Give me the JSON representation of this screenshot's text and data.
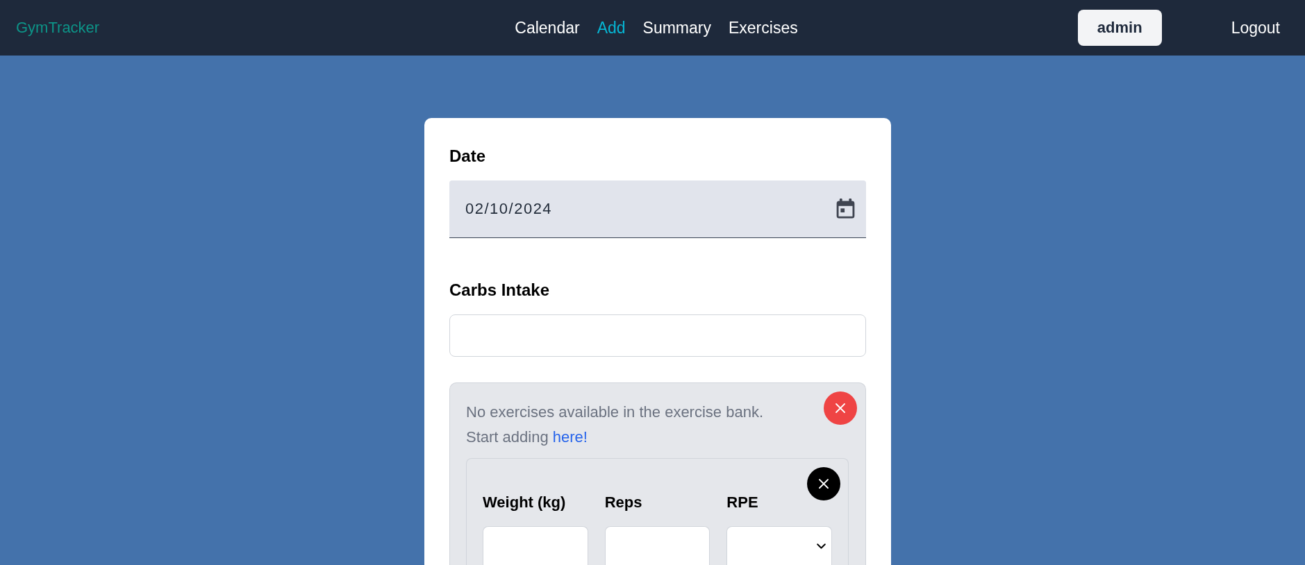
{
  "navbar": {
    "brand": "GymTracker",
    "links": [
      {
        "label": "Calendar",
        "selected": false
      },
      {
        "label": "Add",
        "selected": true
      },
      {
        "label": "Summary",
        "selected": false
      },
      {
        "label": "Exercises",
        "selected": false
      }
    ],
    "user": "admin",
    "logout": "Logout"
  },
  "form": {
    "date": {
      "label": "Date",
      "value": "02/10/2024"
    },
    "carbs": {
      "label": "Carbs Intake"
    },
    "exercise": {
      "message": "No exercises available in the exercise bank.",
      "prompt": "Start adding",
      "link": "here!",
      "sets": [
        {
          "fields": [
            {
              "kind": "number",
              "label": "Weight (kg)"
            },
            {
              "kind": "number",
              "label": "Reps"
            },
            {
              "kind": "select",
              "label": "RPE"
            }
          ]
        }
      ]
    }
  }
}
